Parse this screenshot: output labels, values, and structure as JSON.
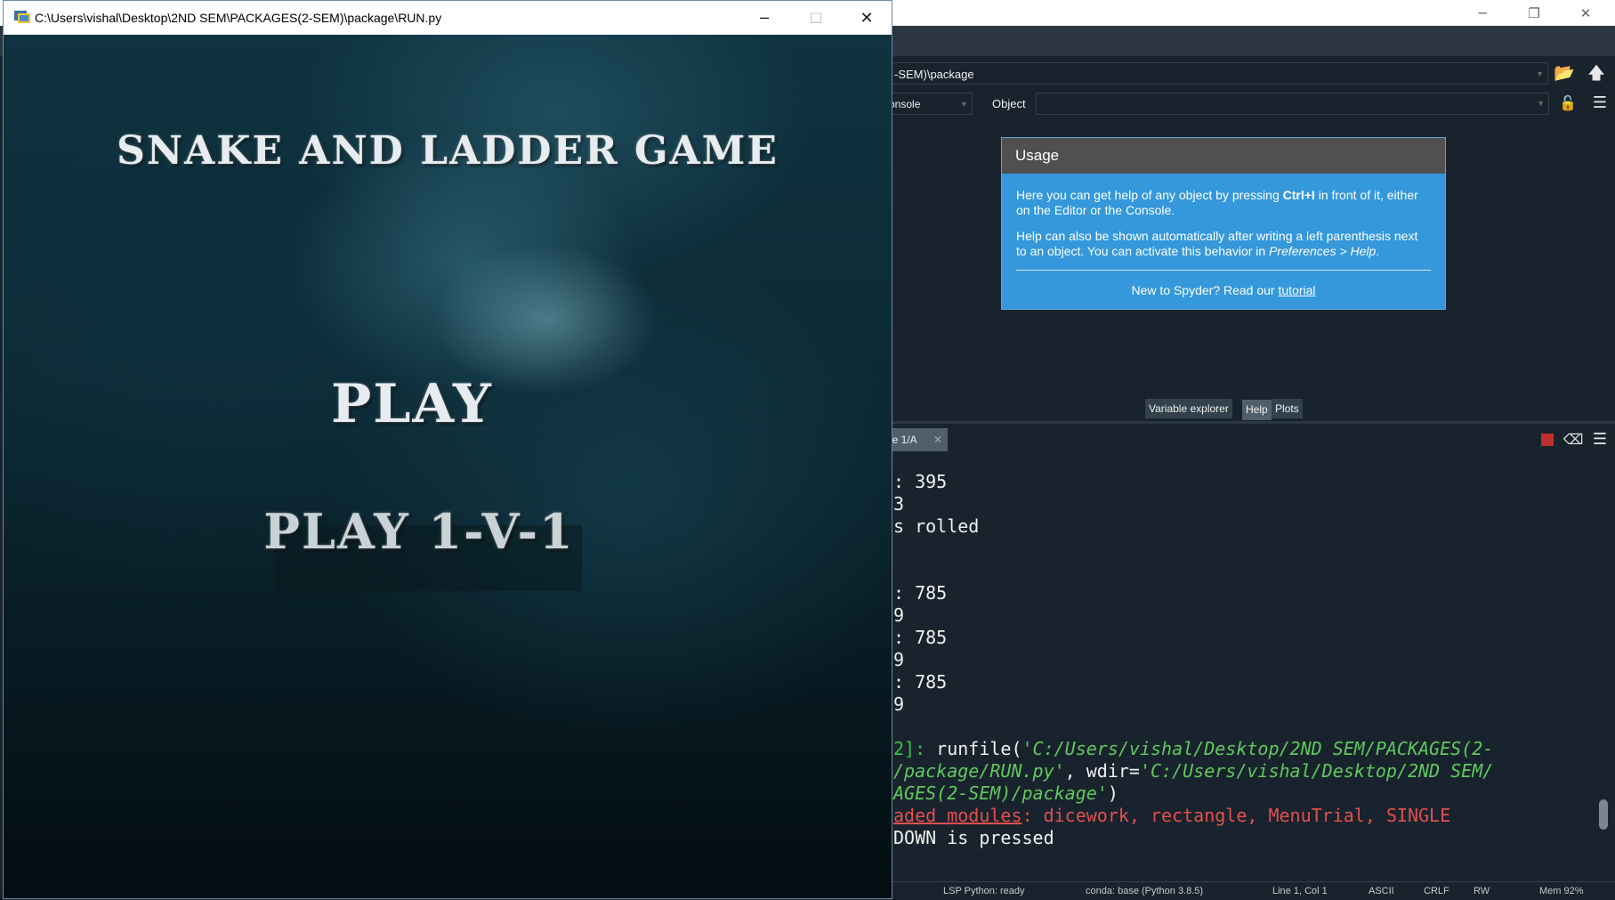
{
  "spyder": {
    "path_fragment": "-SEM)\\package",
    "source_combo": "onsole",
    "object_label": "Object",
    "usage": {
      "title": "Usage",
      "p1_pre": "Here you can get help of any object by pressing ",
      "p1_bold": "Ctrl+I",
      "p1_post": " in front of it, either on the Editor or the Console.",
      "p2_pre": "Help can also be shown automatically after writing a left parenthesis next to an object. You can activate this behavior in ",
      "p2_italic": "Preferences > Help",
      "p2_post": ".",
      "footer_pre": "New to Spyder? Read our ",
      "footer_link": "tutorial"
    },
    "pane_tabs": [
      "Variable explorer",
      "Help",
      "Plots"
    ],
    "console_tab": "le 1/A",
    "console_lines": [
      ": 395",
      "3",
      "s rolled",
      ": 785",
      "9",
      ": 785",
      "9",
      ": 785",
      "9"
    ],
    "runfile": {
      "prompt": "2]: ",
      "cmd": "runfile(",
      "arg1_a": "'C:/Users/vishal/Desktop/2ND SEM/PACKAGES(2-",
      "arg1_b": "/package/RUN.py'",
      "wdir_label": ", wdir=",
      "arg2_a": "'C:/Users/vishal/Desktop/2ND SEM/",
      "arg2_b": "AGES(2-SEM)/package'",
      "close": ")"
    },
    "reload_underlined": "aded modules",
    "reload_rest": ": dicework, rectangle, MenuTrial, SINGLE",
    "last_output": "DOWN is pressed",
    "status": {
      "lsp": "LSP Python: ready",
      "conda": "conda: base (Python 3.8.5)",
      "position": "Line 1, Col 1",
      "encoding": "ASCII",
      "eol": "CRLF",
      "rw": "RW",
      "mem": "Mem 92%"
    }
  },
  "game": {
    "window_title": "C:\\Users\\vishal\\Desktop\\2ND SEM\\PACKAGES(2-SEM)\\package\\RUN.py",
    "heading": "SNAKE AND LADDER GAME",
    "play": "PLAY",
    "play_1v1": "PLAY 1-V-1"
  }
}
